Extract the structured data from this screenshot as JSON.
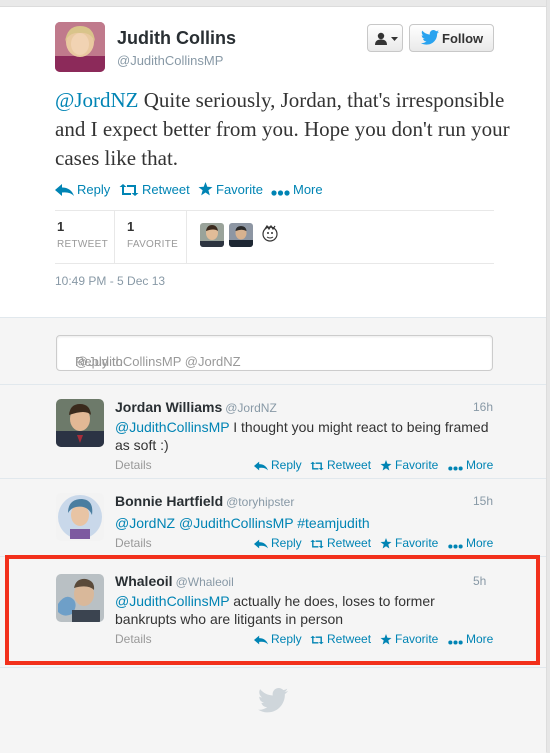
{
  "tweet": {
    "author_name": "Judith Collins",
    "author_handle": "@JudithCollinsMP",
    "follow_label": "Follow",
    "text_mention": "@JordNZ",
    "text_body": " Quite seriously, Jordan, that's irresponsible and I expect better from you. Hope you don't run your cases like that.",
    "actions": {
      "reply": "Reply",
      "retweet": "Retweet",
      "favorite": "Favorite",
      "more": "More"
    },
    "stats": {
      "retweet_count": "1",
      "retweet_label": "RETWEET",
      "favorite_count": "1",
      "favorite_label": "FAVORITE"
    },
    "timestamp": "10:49 PM - 5 Dec 13"
  },
  "reply_box": {
    "placeholder_prefix": "Reply to ",
    "placeholder_mentions": "@JudithCollinsMP @JordNZ"
  },
  "replies": [
    {
      "name": "Jordan Williams",
      "handle": "@JordNZ",
      "time": "16h",
      "mention": "@JudithCollinsMP",
      "text": " I thought you might react to being framed as soft :)",
      "details": "Details"
    },
    {
      "name": "Bonnie Hartfield",
      "handle": "@toryhipster",
      "time": "15h",
      "mention1": "@JordNZ",
      "mention2": "@JudithCollinsMP",
      "hashtag": "#teamjudith",
      "details": "Details"
    },
    {
      "name": "Whaleoil",
      "handle": "@Whaleoil",
      "time": "5h",
      "mention": "@JudithCollinsMP",
      "text": " actually he does, loses to former bankrupts who are litigants in person",
      "details": "Details"
    }
  ],
  "reply_actions": {
    "reply": "Reply",
    "retweet": "Retweet",
    "favorite": "Favorite",
    "more": "More"
  },
  "colors": {
    "link": "#0084b4",
    "highlight": "#f2301b",
    "name": "#292f33",
    "muted": "#8899a6"
  }
}
